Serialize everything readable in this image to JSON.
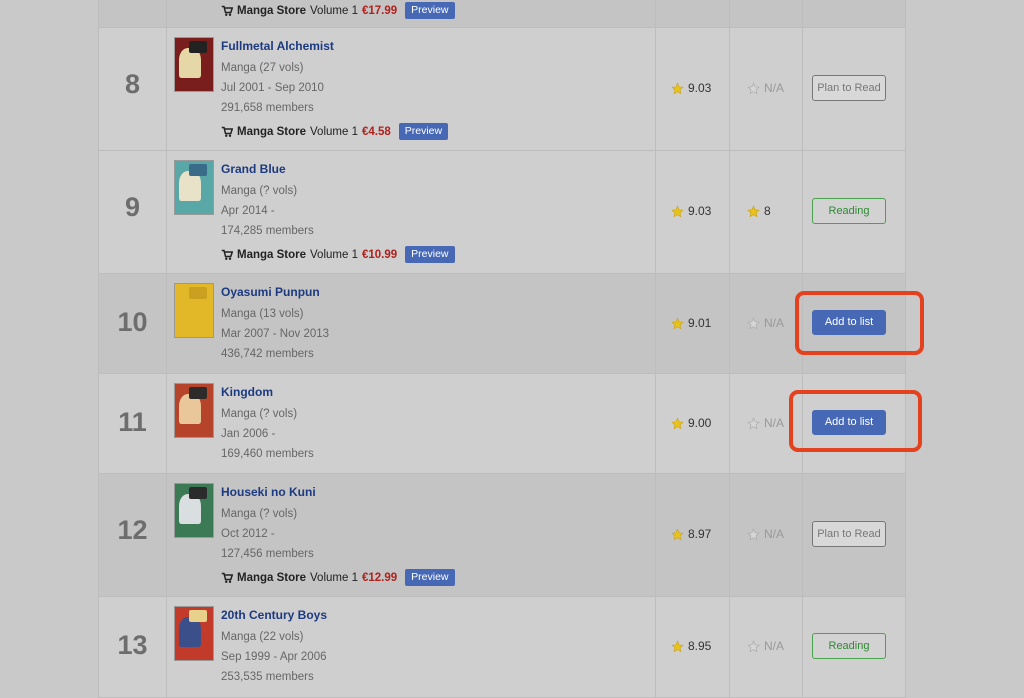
{
  "common": {
    "preview_label": "Preview",
    "store_brand": "Manga Store",
    "volume_label": "Volume 1"
  },
  "top_partial": {
    "price": "€17.99"
  },
  "rows": [
    {
      "rank": "8",
      "title": "Fullmetal Alchemist",
      "type_vols": "Manga (27 vols)",
      "dates": "Jul 2001 - Sep 2010",
      "members": "291,658 members",
      "has_store": true,
      "price": "€4.58",
      "score": "9.03",
      "my_score": "N/A",
      "status_label": "Plan to Read",
      "status_kind": "plan",
      "cover_colors": [
        "#7a1d1d",
        "#e6d7a6",
        "#222222"
      ]
    },
    {
      "rank": "9",
      "title": "Grand Blue",
      "type_vols": "Manga (? vols)",
      "dates": "Apr 2014 -",
      "members": "174,285 members",
      "has_store": true,
      "price": "€10.99",
      "score": "9.03",
      "my_score": "8",
      "status_label": "Reading",
      "status_kind": "reading",
      "cover_colors": [
        "#5aa7a8",
        "#e8e2c8",
        "#3a6c8a"
      ]
    },
    {
      "rank": "10",
      "title": "Oyasumi Punpun",
      "type_vols": "Manga (13 vols)",
      "dates": "Mar 2007 - Nov 2013",
      "members": "436,742 members",
      "has_store": false,
      "score": "9.01",
      "my_score": "N/A",
      "status_label": "Add to list",
      "status_kind": "add",
      "cover_colors": [
        "#e2b828",
        "#e2b828",
        "#c9a020"
      ]
    },
    {
      "rank": "11",
      "title": "Kingdom",
      "type_vols": "Manga (? vols)",
      "dates": "Jan 2006 -",
      "members": "169,460 members",
      "has_store": false,
      "score": "9.00",
      "my_score": "N/A",
      "status_label": "Add to list",
      "status_kind": "add",
      "cover_colors": [
        "#b5442a",
        "#e9c79b",
        "#2d2a2a"
      ]
    },
    {
      "rank": "12",
      "title": "Houseki no Kuni",
      "type_vols": "Manga (? vols)",
      "dates": "Oct 2012 -",
      "members": "127,456 members",
      "has_store": true,
      "price": "€12.99",
      "score": "8.97",
      "my_score": "N/A",
      "status_label": "Plan to Read",
      "status_kind": "plan",
      "cover_colors": [
        "#3c7a56",
        "#d9dfe0",
        "#2b2b2b"
      ]
    },
    {
      "rank": "13",
      "title": "20th Century Boys",
      "type_vols": "Manga (22 vols)",
      "dates": "Sep 1999 - Apr 2006",
      "members": "253,535 members",
      "has_store": false,
      "score": "8.95",
      "my_score": "N/A",
      "status_label": "Reading",
      "status_kind": "reading",
      "cover_colors": [
        "#c23a2a",
        "#3b4f8a",
        "#e8d18a"
      ]
    }
  ],
  "colors": {
    "accent_blue": "#4769b5",
    "title_blue": "#1c3a80",
    "price_red": "#b0201c",
    "reading_green": "#4aa24e",
    "highlight_red": "#e4421e",
    "star_gold": "#e9c21a"
  }
}
